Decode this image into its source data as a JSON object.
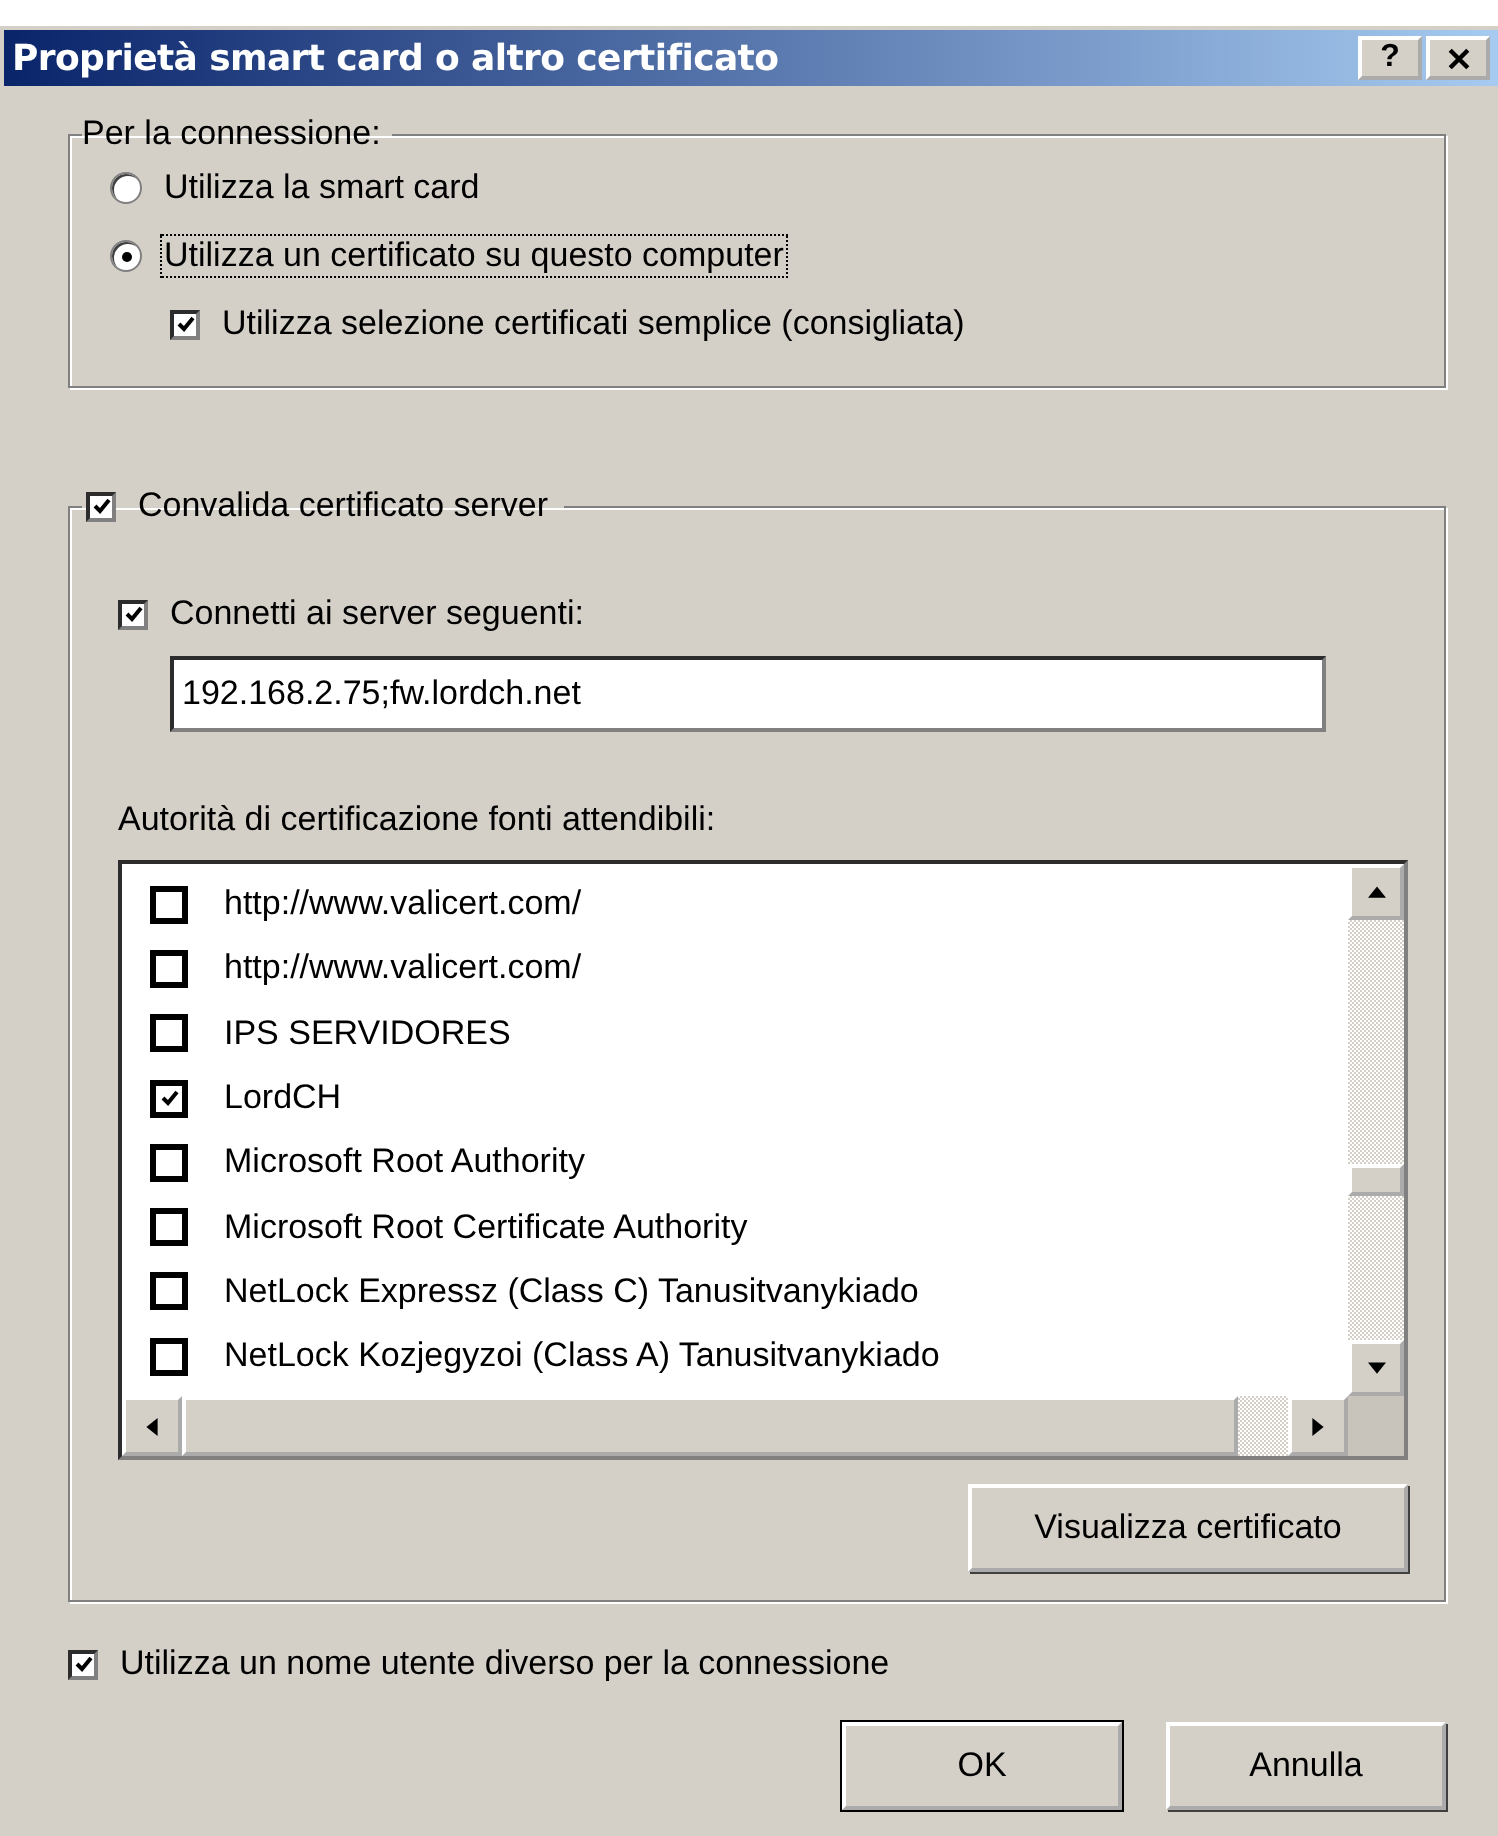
{
  "window": {
    "title": "Proprietà smart card o altro certificato",
    "help": "?"
  },
  "connection_group": {
    "legend": "Per la connessione:",
    "options": [
      {
        "kind": "radio",
        "label": "Utilizza la smart card",
        "selected": false,
        "focused": false
      },
      {
        "kind": "radio",
        "label": "Utilizza un certificato su questo computer",
        "selected": true,
        "focused": true
      },
      {
        "kind": "checkbox",
        "label": "Utilizza selezione certificati semplice (consigliata)",
        "checked": true
      }
    ]
  },
  "server_group": {
    "legend": "Convalida certificato server",
    "checked": true,
    "servers_checkbox": {
      "label": "Connetti ai server seguenti:",
      "checked": true
    },
    "servers_field": {
      "value": "192.168.2.75;fw.lordch.net"
    },
    "list_label": "Autorità di certificazione fonti attendibili:",
    "authorities": [
      {
        "label": "http://www.valicert.com/",
        "checked": false
      },
      {
        "label": "http://www.valicert.com/",
        "checked": false
      },
      {
        "label": "IPS SERVIDORES",
        "checked": false
      },
      {
        "label": "LordCH",
        "checked": true
      },
      {
        "label": "Microsoft Root Authority",
        "checked": false
      },
      {
        "label": "Microsoft Root Certificate Authority",
        "checked": false
      },
      {
        "label": "NetLock Expressz (Class C) Tanusitvanykiado",
        "checked": false
      },
      {
        "label": "NetLock Kozjegyzoi (Class A) Tanusitvanykiado",
        "checked": false
      }
    ],
    "view_button": "Visualizza certificato"
  },
  "different_user": {
    "label": "Utilizza un nome utente diverso per la connessione",
    "checked": true
  },
  "buttons": [
    "OK",
    "Annulla"
  ]
}
